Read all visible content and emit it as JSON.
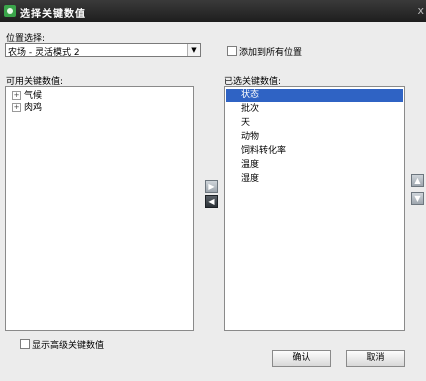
{
  "window": {
    "title": "选择关键数值",
    "close": "x"
  },
  "location": {
    "label": "位置选择:",
    "selected": "农场 - 灵活模式 2",
    "add_all_label": "添加到所有位置"
  },
  "available": {
    "label": "可用关键数值:",
    "items": [
      {
        "expander": "⊞",
        "label": "气候"
      },
      {
        "expander": "⊞",
        "label": "肉鸡"
      }
    ]
  },
  "selected_list": {
    "label": "已选关键数值:",
    "items": [
      "状态",
      "批次",
      "天",
      "动物",
      "饲料转化率",
      "温度",
      "湿度"
    ]
  },
  "show_advanced_label": "显示高级关键数值",
  "buttons": {
    "ok": "确认",
    "cancel": "取消"
  },
  "icons": {
    "move_right": "▶",
    "move_left": "◀",
    "move_up": "▲",
    "move_down": "▼"
  }
}
